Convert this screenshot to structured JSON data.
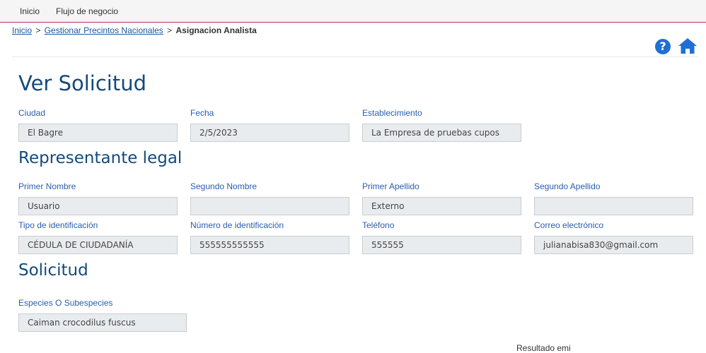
{
  "topnav": {
    "items": [
      "Inicio",
      "Flujo de negocio"
    ]
  },
  "breadcrumb": {
    "items": [
      "Inicio",
      "Gestionar Precintos Nacionales"
    ],
    "separator": ">",
    "current": "Asignacion Analista"
  },
  "icons": {
    "help": "?",
    "help_icon": "help-circle-icon",
    "home_icon": "home-icon",
    "accent": "#1f6fd6"
  },
  "page_title": "Ver Solicitud",
  "general": {
    "ciudad": {
      "label": "Ciudad",
      "value": "El Bagre"
    },
    "fecha": {
      "label": "Fecha",
      "value": "2/5/2023"
    },
    "establecimiento": {
      "label": "Establecimiento",
      "value": "La Empresa de pruebas cupos"
    }
  },
  "representante": {
    "title": "Representante legal",
    "primer_nombre": {
      "label": "Primer Nombre",
      "value": "Usuario"
    },
    "segundo_nombre": {
      "label": "Segundo Nombre",
      "value": ""
    },
    "primer_apellido": {
      "label": "Primer Apellido",
      "value": "Externo"
    },
    "segundo_apellido": {
      "label": "Segundo Apellido",
      "value": ""
    },
    "tipo_id": {
      "label": "Tipo de identificación",
      "value": "CÉDULA DE CIUDADANÍA"
    },
    "numero_id": {
      "label": "Número de identificación",
      "value": "555555555555"
    },
    "telefono": {
      "label": "Teléfono",
      "value": "555555"
    },
    "correo": {
      "label": "Correo electrónico",
      "value": "julianabisa830@gmail.com"
    }
  },
  "solicitud": {
    "title": "Solicitud",
    "especies": {
      "label": "Especies O Subespecies",
      "value": "Caiman crocodilus fuscus"
    },
    "partial_text": "Resultado emi"
  }
}
